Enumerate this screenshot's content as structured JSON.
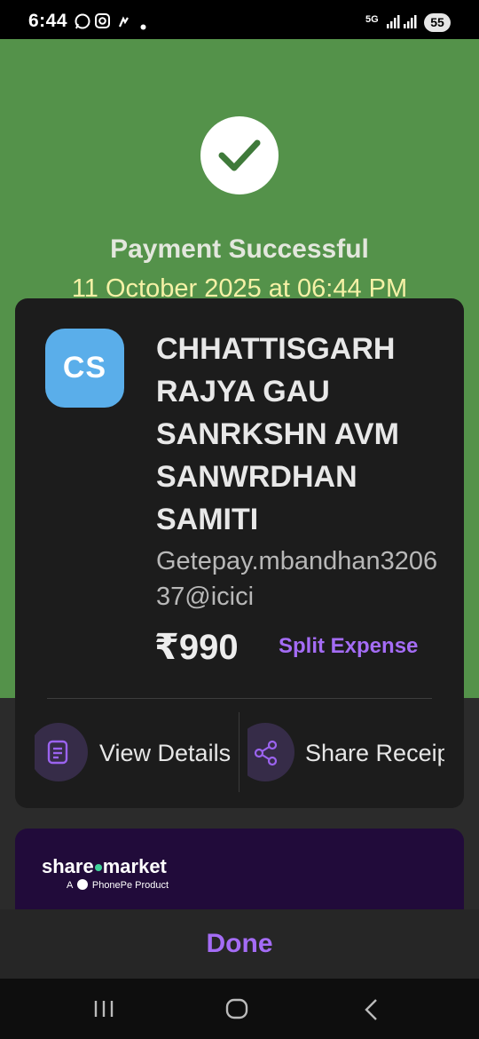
{
  "status_bar": {
    "time": "6:44",
    "network": "5G",
    "battery": "55",
    "icons": [
      "whatsapp-icon",
      "instagram-icon",
      "app-notification-icon",
      "dot-icon",
      "signal-icon",
      "battery-icon"
    ]
  },
  "header": {
    "title": "Payment Successful",
    "date": "11 October 2025 at 06:44 PM",
    "background_color": "#54924a",
    "title_color": "#e3e7dd",
    "date_color": "#f5f1a6"
  },
  "merchant": {
    "initials": "CS",
    "name": "CHHATTISGARH RAJYA GAU SANRKSHN AVM SANWRDHAN SAMITI",
    "upi_id": "Getepay.mbandhan320637@icici",
    "avatar_color": "#5aaeea"
  },
  "payment": {
    "amount": "₹990",
    "split_label": "Split Expense",
    "accent_color": "#a46cf5"
  },
  "actions": {
    "view_details": "View Details",
    "share_receipt": "Share Receipt"
  },
  "promo": {
    "brand_left": "share",
    "brand_right": "market",
    "sub_prefix": "A",
    "sub_suffix": "PhonePe Product"
  },
  "footer": {
    "done_label": "Done"
  },
  "nav": [
    "recents-icon",
    "home-icon",
    "back-icon"
  ]
}
